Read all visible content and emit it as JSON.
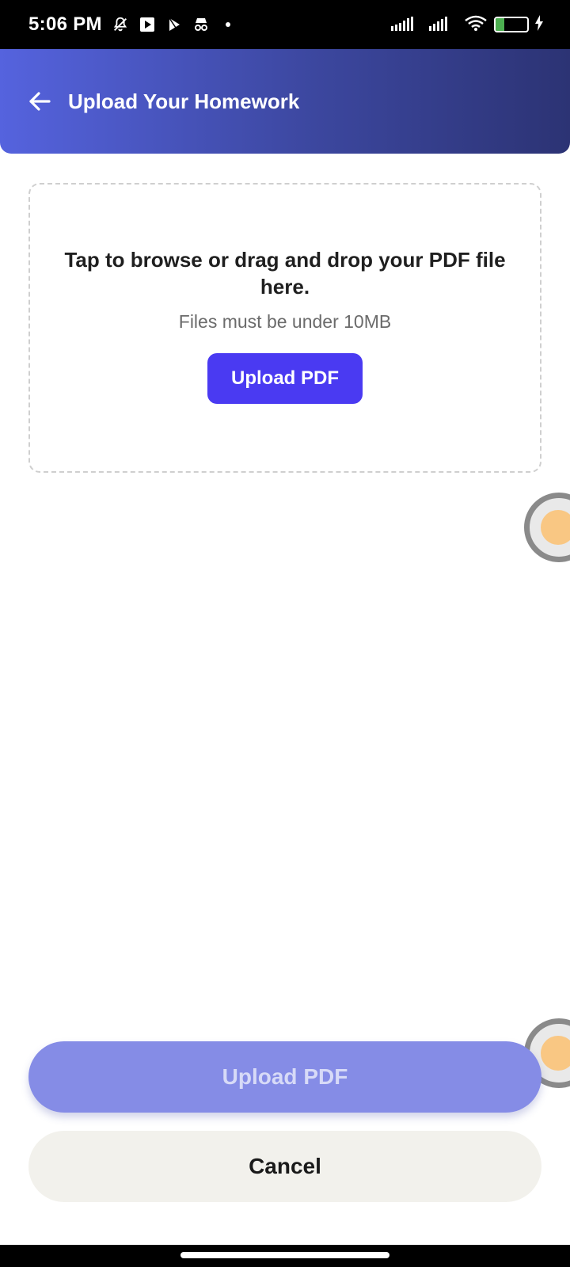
{
  "status_bar": {
    "time": "5:06 PM",
    "battery_level": "27",
    "icons": [
      "bell-off-icon",
      "play-box-icon",
      "play-store-icon",
      "incognito-icon",
      "dot-icon",
      "signal-icon",
      "signal-icon-2",
      "wifi-icon",
      "battery-icon",
      "charging-icon"
    ]
  },
  "header": {
    "title": "Upload Your Homework",
    "back_icon": "arrow-left-icon",
    "gradient_start": "#5563de",
    "gradient_end": "#2c3374"
  },
  "dropzone": {
    "title": "Tap to browse or drag and drop your PDF file here.",
    "subtitle": "Files must be under 10MB",
    "button_label": "Upload PDF",
    "button_color": "#4a3af2"
  },
  "footer": {
    "primary_label": "Upload PDF",
    "cancel_label": "Cancel",
    "primary_color": "#858ce6",
    "cancel_color": "#f2f1ec"
  }
}
